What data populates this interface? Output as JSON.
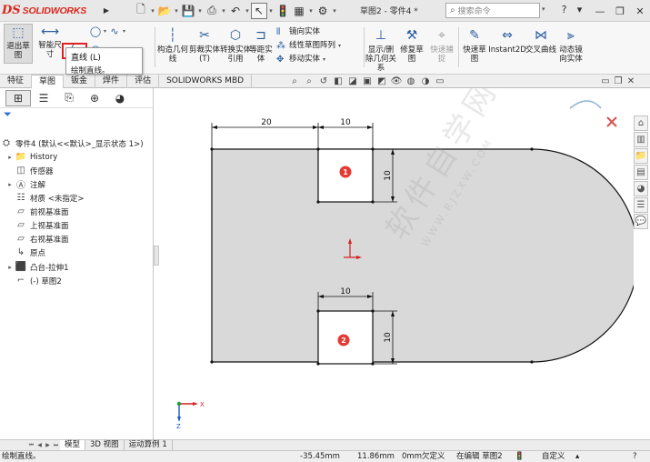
{
  "app": {
    "logo_text": "SOLIDWORKS",
    "logo_mark": "DS",
    "document_title": "草图2 - 零件4 *",
    "search_placeholder": "搜索命令",
    "help_icon": "?",
    "window_min": "—",
    "window_restore": "❐",
    "window_close": "✕"
  },
  "ribbon": {
    "exit_sketch": "退出草图",
    "smart_dimension": "智能尺寸",
    "construction_geometry": "构造几何线",
    "trim_entities": "剪裁实体(T)",
    "convert_entities": "转换实体引用",
    "offset_entities": "等距实体",
    "mirror_entities": "镜向实体",
    "linear_pattern": "线性草图阵列",
    "move_entities": "移动实体",
    "display_relations": "显示/删除几何关系",
    "repair_sketch": "修复草图",
    "quick_snaps": "快速捕捉",
    "rapid_sketch": "快速草图",
    "instant2d": "Instant2D",
    "intersection_curve": "交叉曲线",
    "dynamic_mirror": "动态镜向实体"
  },
  "tooltip": {
    "title": "直线  (L)",
    "description": "绘制直线。"
  },
  "tabs": [
    {
      "label": "特征"
    },
    {
      "label": "草图"
    },
    {
      "label": "钣金"
    },
    {
      "label": "焊件"
    },
    {
      "label": "评估"
    },
    {
      "label": "SOLIDWORKS MBD"
    }
  ],
  "tree": {
    "root": "零件4 (默认<<默认>_显示状态 1>)",
    "items": [
      {
        "label": "History"
      },
      {
        "label": "传感器"
      },
      {
        "label": "注解"
      },
      {
        "label": "材质 <未指定>"
      },
      {
        "label": "前视基准面"
      },
      {
        "label": "上视基准面"
      },
      {
        "label": "右视基准面"
      },
      {
        "label": "原点"
      },
      {
        "label": "凸台-拉伸1"
      },
      {
        "label": "(-) 草图2"
      }
    ]
  },
  "sketch": {
    "dim_top_left": "20",
    "dim_top_width": "10",
    "dim_top_height": "10",
    "dim_bottom_width": "10",
    "dim_bottom_height": "10",
    "marker_1": "1",
    "marker_2": "2",
    "fill_color": "#d9d9d9",
    "marker_color": "#e53935"
  },
  "triad": {
    "x_label": "X",
    "y_label": "Z"
  },
  "watermark": {
    "text": "软件自学网",
    "sub": "WWW.RJZXW.COM"
  },
  "bottom_tabs": [
    {
      "label": "模型"
    },
    {
      "label": "3D 视图"
    },
    {
      "label": "运动算例 1"
    }
  ],
  "status": {
    "message": "绘制直线。",
    "x": "-35.45mm",
    "y": "11.86mm",
    "z": "0mm",
    "state": "欠定义",
    "editing": "在编辑 草图2",
    "units": "自定义"
  }
}
